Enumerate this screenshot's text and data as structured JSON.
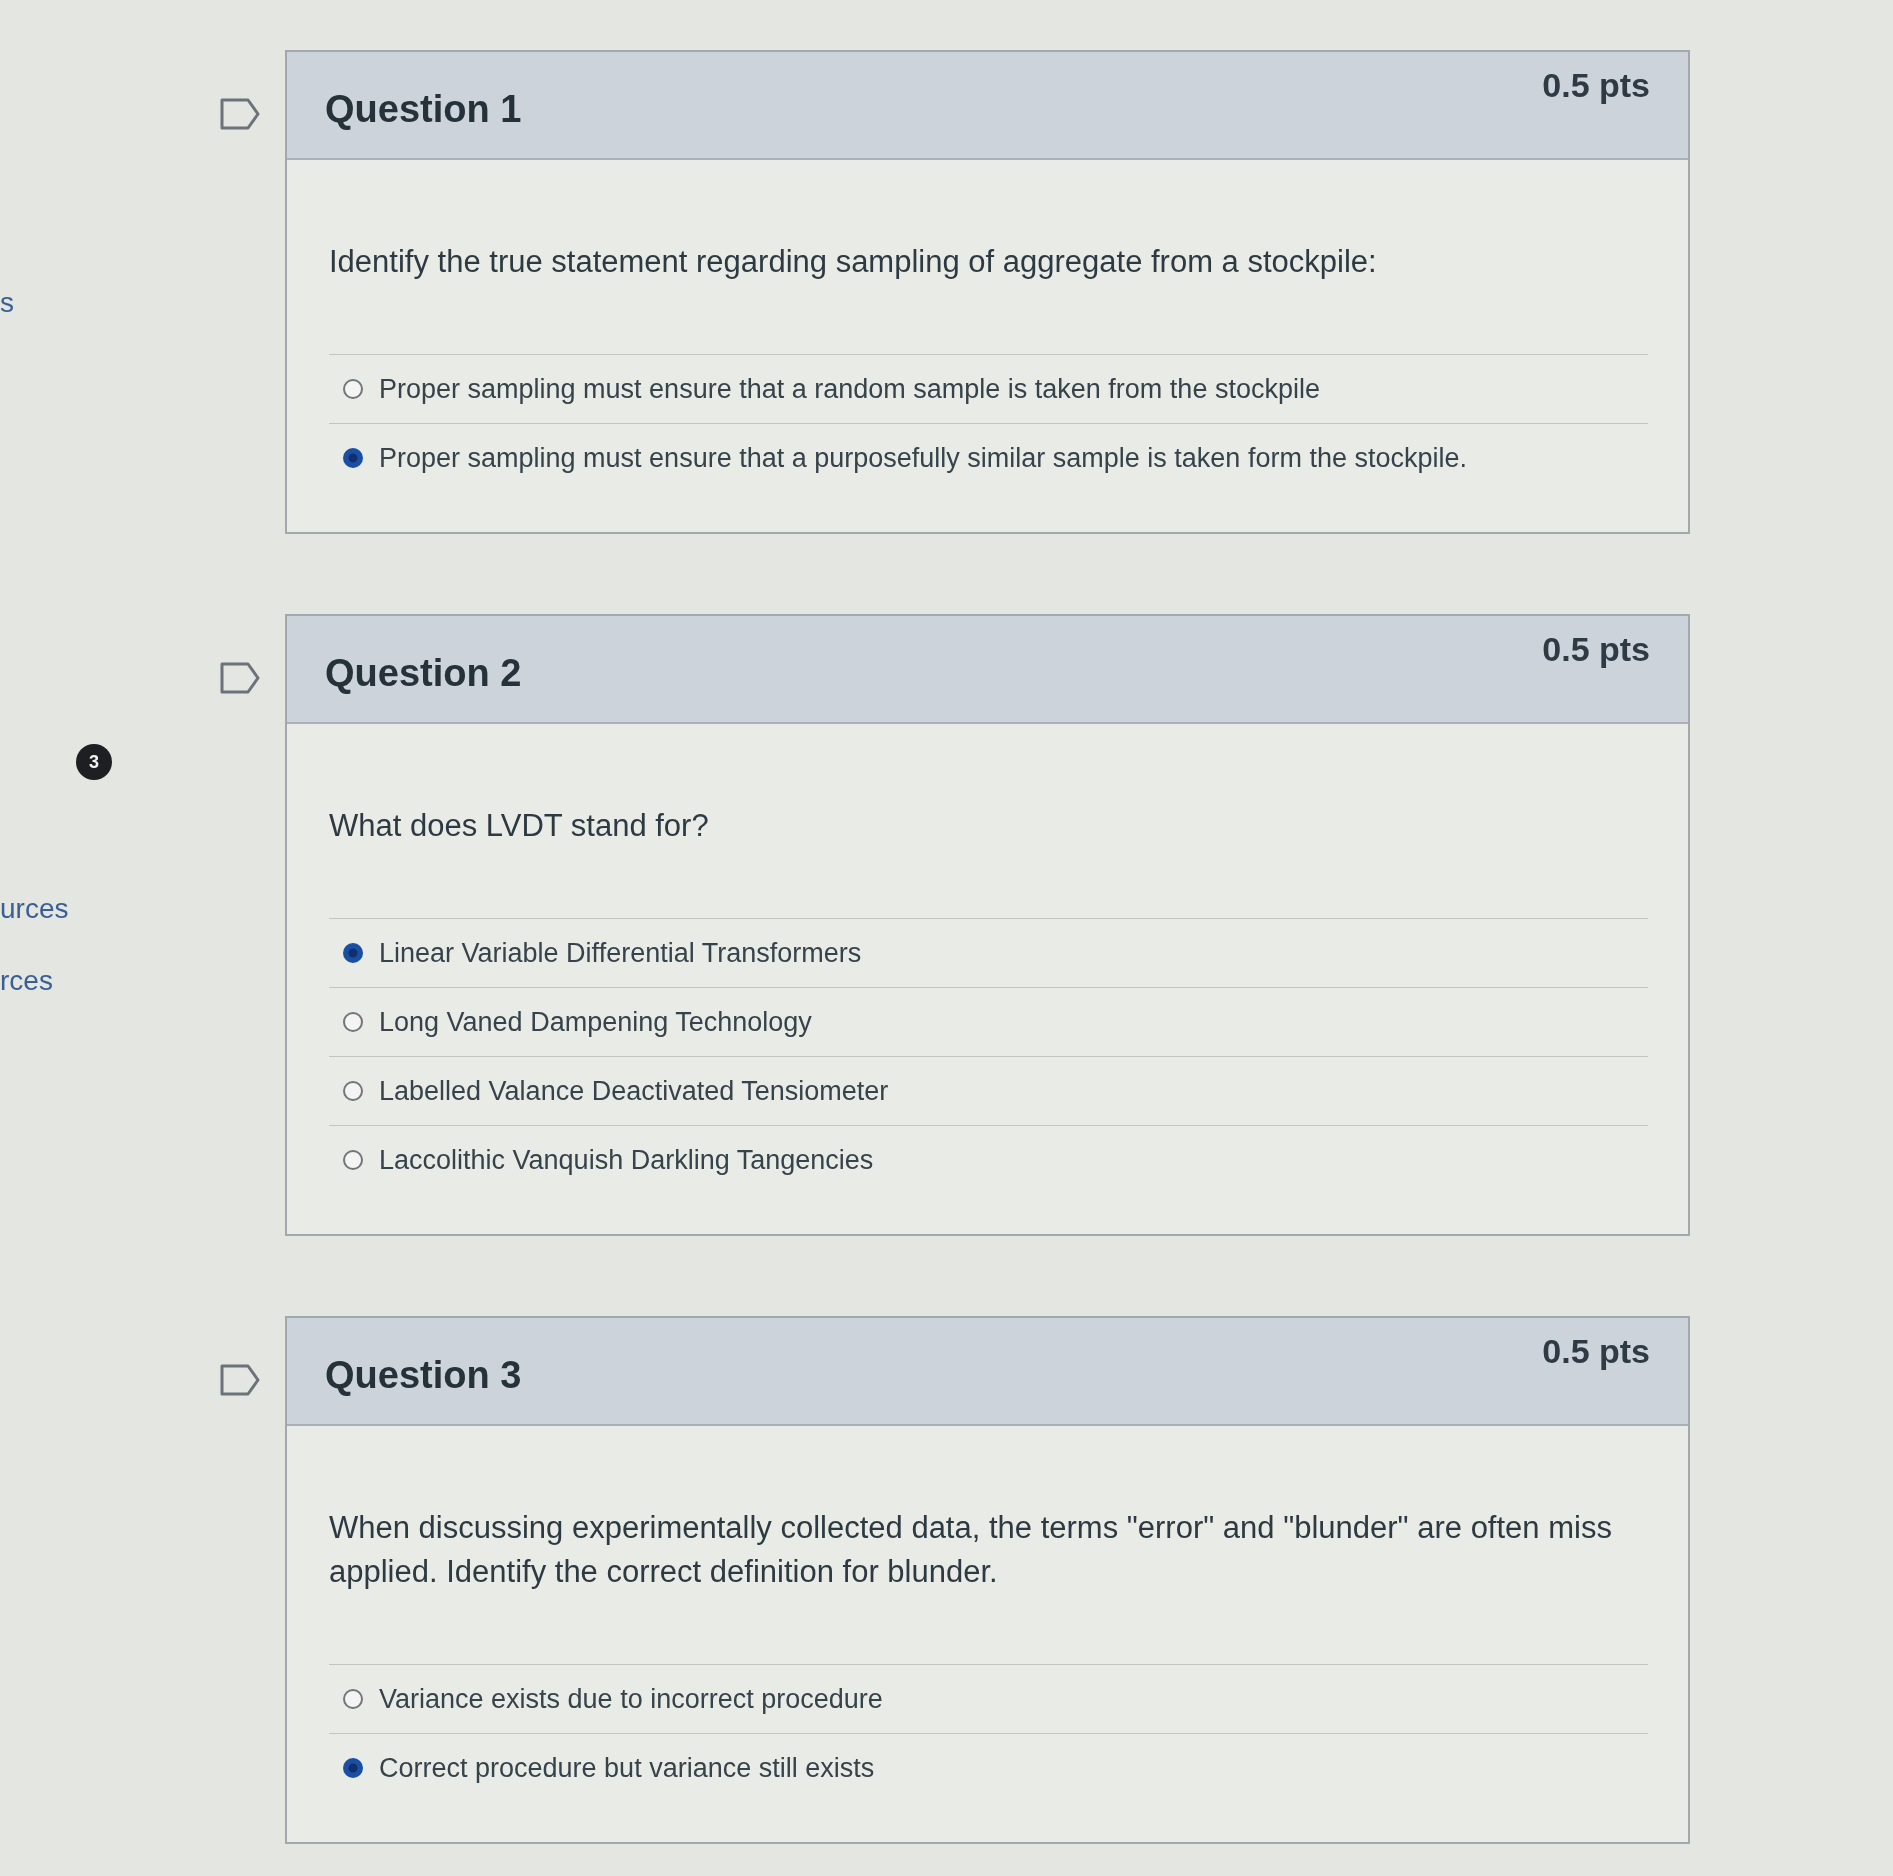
{
  "sidebar": {
    "items": [
      {
        "kind": "text",
        "label": "s"
      },
      {
        "kind": "badge",
        "label": "3"
      },
      {
        "kind": "text",
        "label": "urces"
      },
      {
        "kind": "text",
        "label": "rces"
      }
    ]
  },
  "questions": [
    {
      "title": "Question 1",
      "points": "0.5 pts",
      "text": "Identify the true statement regarding sampling of aggregate from a stockpile:",
      "answers": [
        {
          "label": "Proper sampling must ensure that a random sample is taken from the stockpile",
          "selected": false
        },
        {
          "label": "Proper sampling must ensure that a purposefully similar sample is taken form the stockpile.",
          "selected": true
        }
      ]
    },
    {
      "title": "Question 2",
      "points": "0.5 pts",
      "text": "What does LVDT stand for?",
      "answers": [
        {
          "label": "Linear Variable Differential Transformers",
          "selected": true
        },
        {
          "label": "Long Vaned Dampening Technology",
          "selected": false
        },
        {
          "label": "Labelled Valance Deactivated Tensiometer",
          "selected": false
        },
        {
          "label": "Laccolithic Vanquish Darkling Tangencies",
          "selected": false
        }
      ]
    },
    {
      "title": "Question 3",
      "points": "0.5 pts",
      "text": "When discussing experimentally collected data, the terms \"error\" and \"blunder\" are often miss applied. Identify the correct definition for blunder.",
      "answers": [
        {
          "label": "Variance exists due to incorrect procedure",
          "selected": false
        },
        {
          "label": "Correct procedure but variance still exists",
          "selected": true
        }
      ]
    }
  ]
}
